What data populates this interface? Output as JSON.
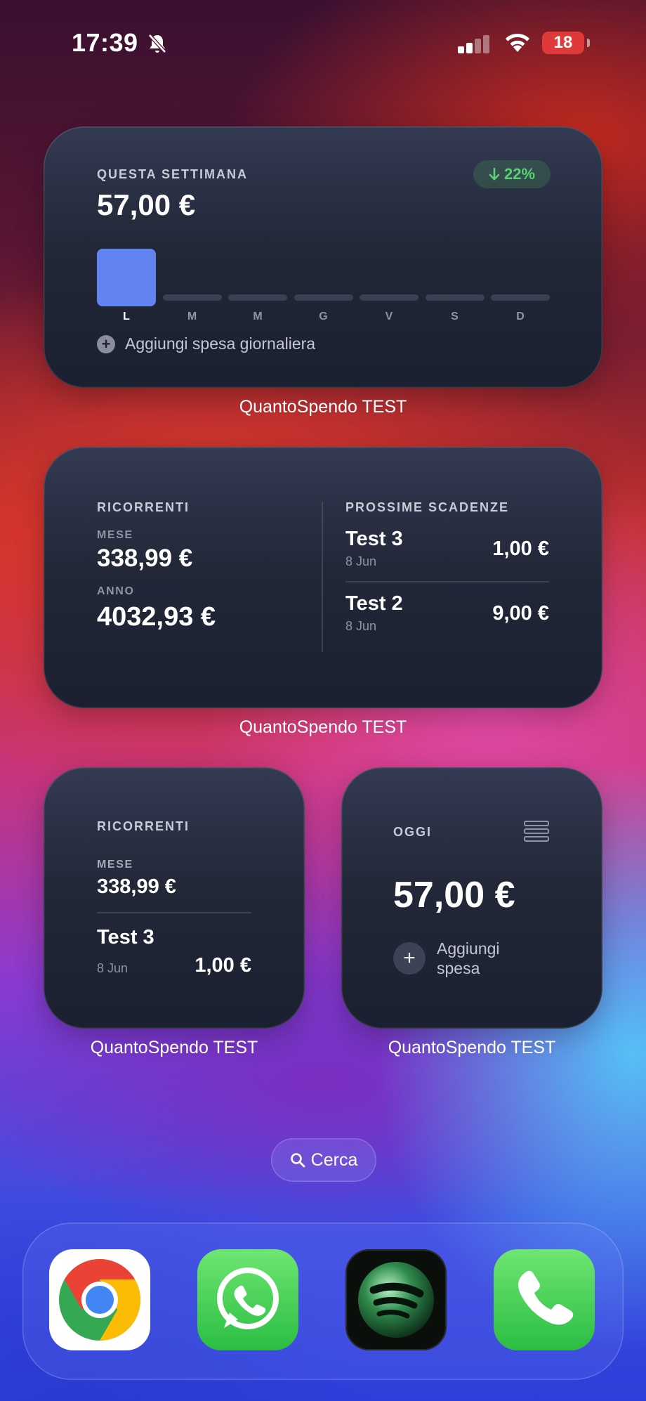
{
  "status_bar": {
    "time": "17:39",
    "battery": "18",
    "icons": [
      "bell-slash-icon",
      "signal-icon",
      "wifi-icon",
      "battery-icon"
    ]
  },
  "widget_weekly": {
    "title": "QUESTA SETTIMANA",
    "amount": "57,00 €",
    "change_badge": "22%",
    "change_direction": "down",
    "days": [
      "L",
      "M",
      "M",
      "G",
      "V",
      "S",
      "D"
    ],
    "day_values_fraction": [
      1,
      0,
      0,
      0,
      0,
      0,
      0
    ],
    "active_day_index": 0,
    "add_label": "Aggiungi spesa giornaliera",
    "caption": "QuantoSpendo TEST"
  },
  "widget_recurring_large": {
    "title": "RICORRENTI",
    "month_label": "MESE",
    "month_amount": "338,99 €",
    "year_label": "ANNO",
    "year_amount": "4032,93 €",
    "upcoming_title": "PROSSIME SCADENZE",
    "upcoming": [
      {
        "name": "Test 3",
        "date": "8 Jun",
        "amount": "1,00 €"
      },
      {
        "name": "Test 2",
        "date": "8 Jun",
        "amount": "9,00 €"
      }
    ],
    "caption": "QuantoSpendo TEST"
  },
  "widget_recurring_small": {
    "title": "RICORRENTI",
    "month_label": "MESE",
    "month_amount": "338,99 €",
    "next": {
      "name": "Test 3",
      "date": "8 Jun",
      "amount": "1,00 €"
    },
    "caption": "QuantoSpendo TEST"
  },
  "widget_today": {
    "title": "OGGI",
    "amount": "57,00 €",
    "add_label": "Aggiungi spesa",
    "caption": "QuantoSpendo TEST"
  },
  "search": {
    "label": "Cerca"
  },
  "dock": {
    "apps": [
      "chrome-icon",
      "whatsapp-icon",
      "spotify-icon",
      "phone-icon"
    ]
  },
  "colors": {
    "bar_active": "#6184f0",
    "badge_green": "#5bd072",
    "battery_red": "#e0393a"
  }
}
